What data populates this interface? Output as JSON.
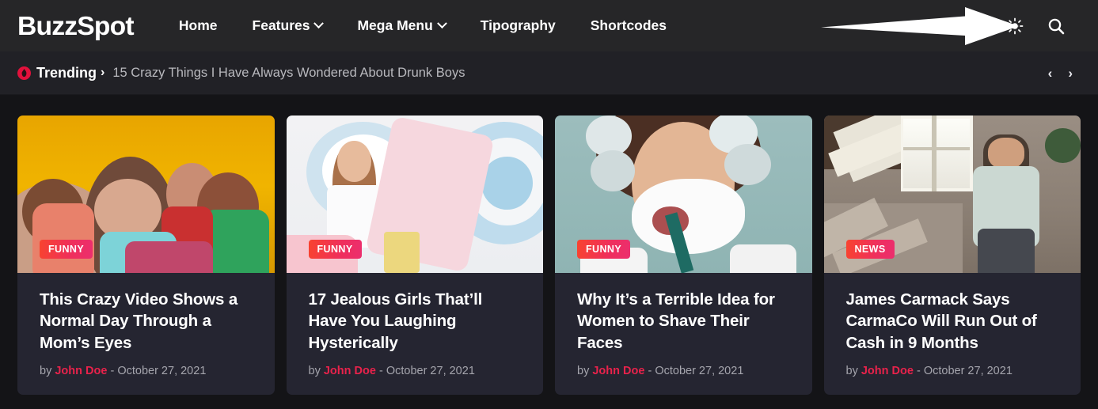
{
  "site": {
    "logo": "BuzzSpot",
    "accent": "#e9224b",
    "badge_gradient_from": "#f8432f",
    "badge_gradient_to": "#ec2e6e",
    "header_bg": "#262628",
    "trending_bg": "#212126",
    "page_bg": "#141417",
    "card_bg": "#252531"
  },
  "nav": {
    "items": [
      {
        "label": "Home",
        "has_dropdown": false
      },
      {
        "label": "Features",
        "has_dropdown": true
      },
      {
        "label": "Mega Menu",
        "has_dropdown": true
      },
      {
        "label": "Tipography",
        "has_dropdown": false
      },
      {
        "label": "Shortcodes",
        "has_dropdown": false
      }
    ],
    "actions": [
      {
        "icon": "sun-icon",
        "label": "Light mode toggle"
      },
      {
        "icon": "search-icon",
        "label": "Search"
      }
    ]
  },
  "annotation": {
    "type": "arrow",
    "points_to": "sun-icon",
    "color": "#ffffff"
  },
  "trending": {
    "label": "Trending",
    "caret": "›",
    "headline": "15 Crazy Things I Have Always Wondered About Drunk Boys",
    "prev": "‹",
    "next": "›"
  },
  "cards": [
    {
      "badge": "FUNNY",
      "title": "This Crazy Video Shows a Normal Day Through a Mom’s Eyes",
      "by": "by",
      "author": "John Doe",
      "sep": "-",
      "date": "October 27, 2021"
    },
    {
      "badge": "FUNNY",
      "title": "17 Jealous Girls That’ll Have You Laughing Hysterically",
      "by": "by",
      "author": "John Doe",
      "sep": "-",
      "date": "October 27, 2021"
    },
    {
      "badge": "FUNNY",
      "title": "Why It’s a Terrible Idea for Women to Shave Their Faces",
      "by": "by",
      "author": "John Doe",
      "sep": "-",
      "date": "October 27, 2021"
    },
    {
      "badge": "NEWS",
      "title": "James Carmack Says CarmaCo Will Run Out of Cash in 9 Months",
      "by": "by",
      "author": "John Doe",
      "sep": "-",
      "date": "October 27, 2021"
    }
  ]
}
